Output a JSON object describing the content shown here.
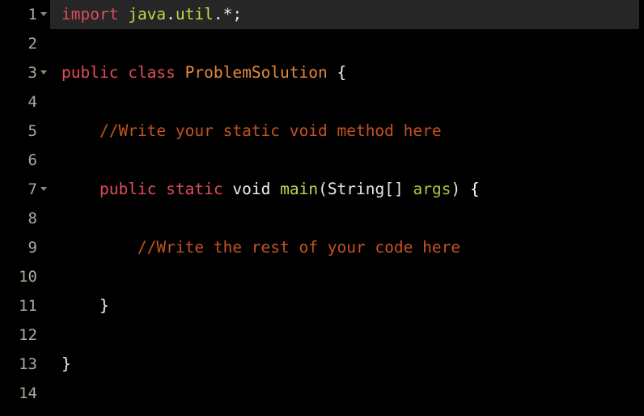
{
  "editor": {
    "language": "java",
    "background_color": "#000000",
    "highlight_color": "#262626",
    "gutter_color": "#000000",
    "line_number_color": "#b0a79b",
    "total_lines": 14,
    "active_line": 1,
    "syntax_colors": {
      "keyword": "#e04c5a",
      "package": "#c4d44a",
      "type": "#e8883a",
      "function": "#c4d44a",
      "variable": "#a8c83c",
      "punctuation": "#e8e8e8",
      "comment": "#c4531f",
      "brace": "#f5f5f5"
    },
    "lines": [
      {
        "number": "1",
        "foldable": true,
        "highlighted": true,
        "indent": 0,
        "tokens": [
          {
            "text": "import",
            "type": "keyword"
          },
          {
            "text": " ",
            "type": "plain"
          },
          {
            "text": "java",
            "type": "package"
          },
          {
            "text": ".",
            "type": "punct"
          },
          {
            "text": "util",
            "type": "package"
          },
          {
            "text": ".",
            "type": "punct"
          },
          {
            "text": "*",
            "type": "punct"
          },
          {
            "text": ";",
            "type": "punct"
          }
        ]
      },
      {
        "number": "2",
        "foldable": false,
        "highlighted": false,
        "indent": 0,
        "tokens": []
      },
      {
        "number": "3",
        "foldable": true,
        "highlighted": false,
        "indent": 0,
        "tokens": [
          {
            "text": "public",
            "type": "keyword"
          },
          {
            "text": " ",
            "type": "plain"
          },
          {
            "text": "class",
            "type": "keyword"
          },
          {
            "text": " ",
            "type": "plain"
          },
          {
            "text": "ProblemSolution",
            "type": "type"
          },
          {
            "text": " ",
            "type": "plain"
          },
          {
            "text": "{",
            "type": "brace"
          }
        ]
      },
      {
        "number": "4",
        "foldable": false,
        "highlighted": false,
        "indent": 0,
        "tokens": []
      },
      {
        "number": "5",
        "foldable": false,
        "highlighted": false,
        "indent": 4,
        "tokens": [
          {
            "text": "//Write your static void method here",
            "type": "comment"
          }
        ]
      },
      {
        "number": "6",
        "foldable": false,
        "highlighted": false,
        "indent": 0,
        "tokens": []
      },
      {
        "number": "7",
        "foldable": true,
        "highlighted": false,
        "indent": 4,
        "tokens": [
          {
            "text": "public",
            "type": "keyword"
          },
          {
            "text": " ",
            "type": "plain"
          },
          {
            "text": "static",
            "type": "keyword"
          },
          {
            "text": " ",
            "type": "plain"
          },
          {
            "text": "void",
            "type": "plain"
          },
          {
            "text": " ",
            "type": "plain"
          },
          {
            "text": "main",
            "type": "func"
          },
          {
            "text": "(",
            "type": "punct"
          },
          {
            "text": "String",
            "type": "punct"
          },
          {
            "text": "[]",
            "type": "punct"
          },
          {
            "text": " ",
            "type": "plain"
          },
          {
            "text": "args",
            "type": "var"
          },
          {
            "text": ")",
            "type": "punct"
          },
          {
            "text": " ",
            "type": "plain"
          },
          {
            "text": "{",
            "type": "brace"
          }
        ]
      },
      {
        "number": "8",
        "foldable": false,
        "highlighted": false,
        "indent": 0,
        "tokens": []
      },
      {
        "number": "9",
        "foldable": false,
        "highlighted": false,
        "indent": 8,
        "tokens": [
          {
            "text": "//Write the rest of your code here",
            "type": "comment"
          }
        ]
      },
      {
        "number": "10",
        "foldable": false,
        "highlighted": false,
        "indent": 0,
        "tokens": []
      },
      {
        "number": "11",
        "foldable": false,
        "highlighted": false,
        "indent": 4,
        "tokens": [
          {
            "text": "}",
            "type": "brace"
          }
        ]
      },
      {
        "number": "12",
        "foldable": false,
        "highlighted": false,
        "indent": 0,
        "tokens": []
      },
      {
        "number": "13",
        "foldable": false,
        "highlighted": false,
        "indent": 0,
        "tokens": [
          {
            "text": "}",
            "type": "brace"
          }
        ]
      },
      {
        "number": "14",
        "foldable": false,
        "highlighted": false,
        "indent": 0,
        "tokens": []
      }
    ]
  }
}
